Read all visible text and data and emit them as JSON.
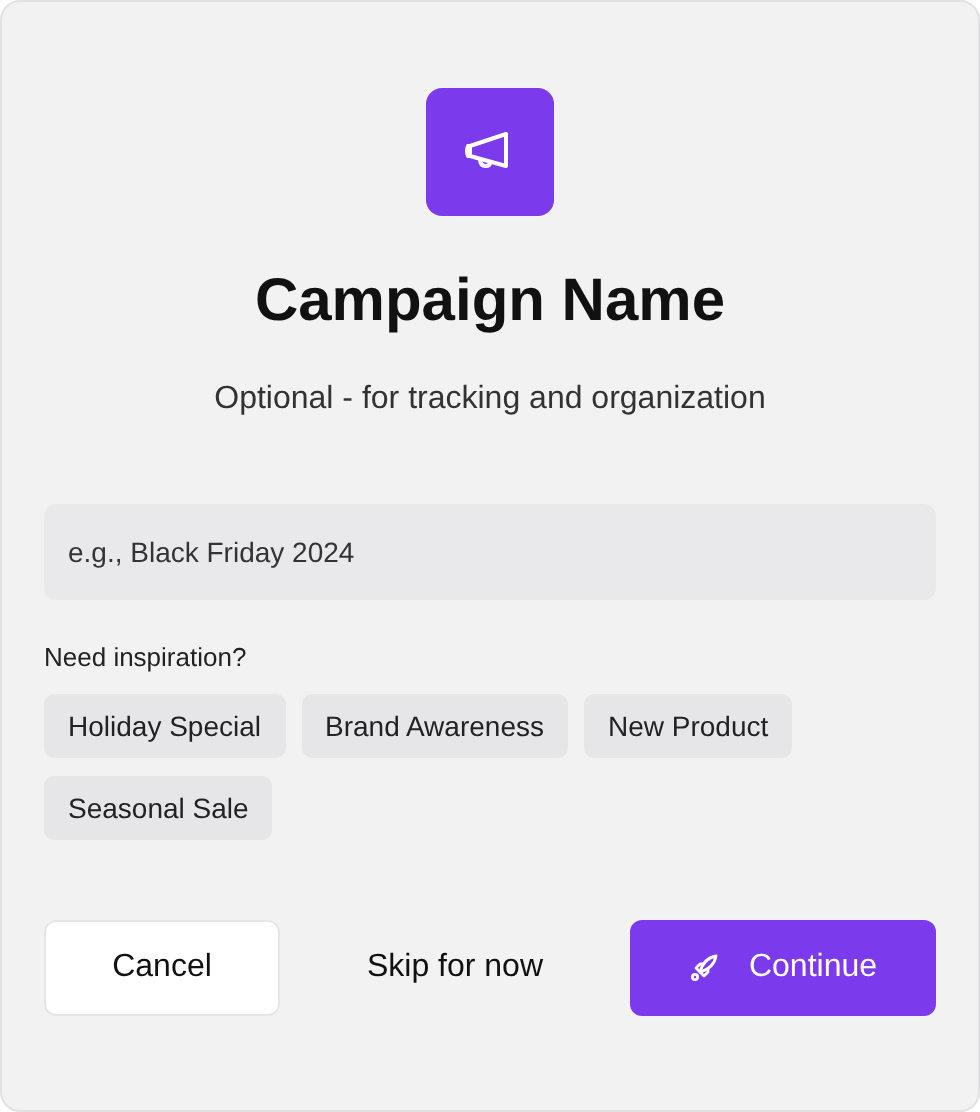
{
  "dialog": {
    "title": "Campaign Name",
    "subtitle": "Optional - for tracking and organization"
  },
  "name_field": {
    "placeholder": "e.g., Black Friday 2024"
  },
  "suggestions": {
    "label": "Need inspiration?",
    "chips": [
      "Holiday Special",
      "Brand Awareness",
      "New Product",
      "Seasonal Sale"
    ]
  },
  "buttons": [
    {
      "label": "Cancel",
      "kind": "secondary"
    },
    {
      "label": "Skip for now",
      "kind": "text"
    },
    {
      "label": "Continue",
      "kind": "primary"
    }
  ]
}
